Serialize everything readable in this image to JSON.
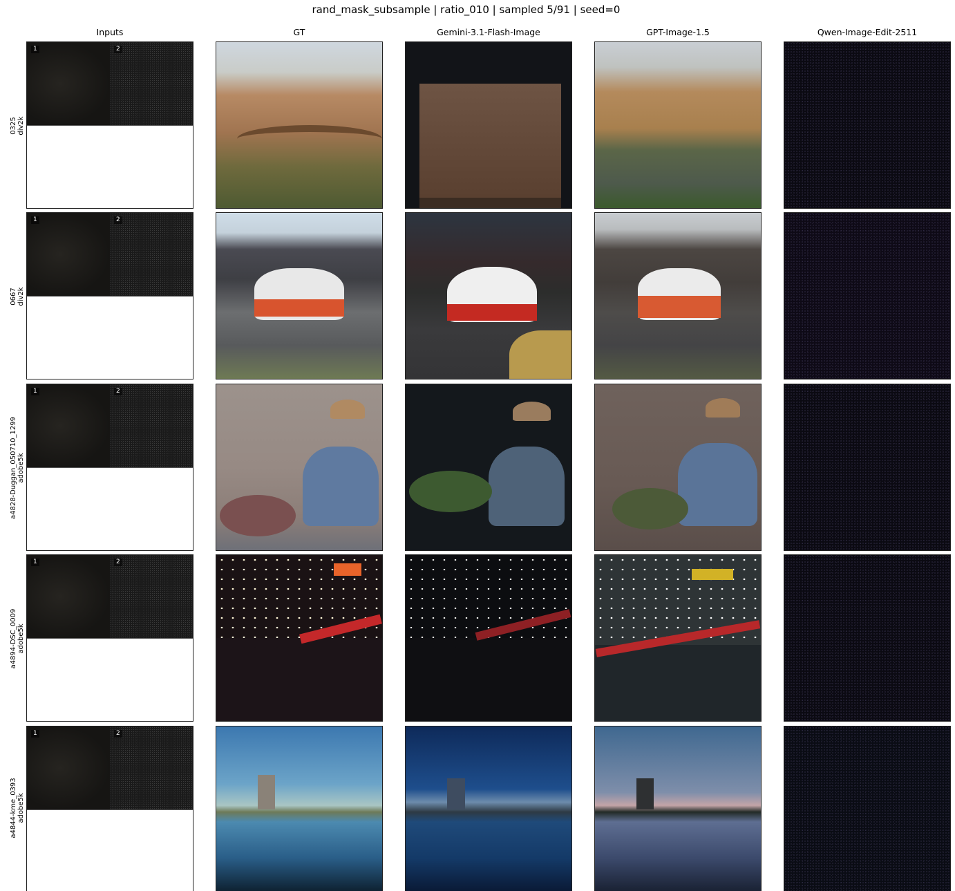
{
  "title": "rand_mask_subsample | ratio_010 | sampled 5/91 | seed=0",
  "columns": [
    "Inputs",
    "GT",
    "Gemini-3.1-Flash-Image",
    "GPT-Image-1.5",
    "Qwen-Image-Edit-2511"
  ],
  "rows": [
    {
      "id": "0325",
      "source": "div2k",
      "badges": [
        "1",
        "2"
      ]
    },
    {
      "id": "0667",
      "source": "div2k",
      "badges": [
        "1",
        "2"
      ]
    },
    {
      "id": "a4828-Duggan_050710_1299",
      "source": "adobe5k",
      "badges": [
        "1",
        "2"
      ]
    },
    {
      "id": "a4894-DSC_0009",
      "source": "adobe5k",
      "badges": [
        "1",
        "2"
      ]
    },
    {
      "id": "a4844-kme_0393",
      "source": "adobe5k",
      "badges": [
        "1",
        "2"
      ]
    }
  ]
}
